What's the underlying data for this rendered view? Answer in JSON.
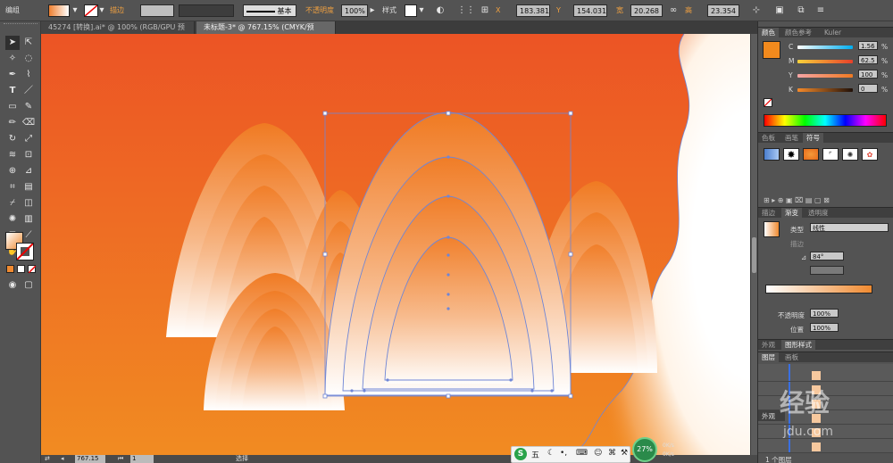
{
  "control_bar": {
    "selection_label": "编组",
    "stroke_label": "描边",
    "stroke_style": "基本",
    "opacity_label": "不透明度",
    "opacity_value": "100%",
    "style_label": "样式",
    "x_label": "X",
    "x_value": "183.381",
    "y_label": "Y",
    "y_value": "154.031",
    "w_label": "宽",
    "w_value": "20.268",
    "h_label": "高",
    "h_value": "23.354"
  },
  "tabs": [
    {
      "label": "45274 [转换].ai* @ 100% (RGB/GPU 预览)",
      "active": false
    },
    {
      "label": "未标题-3* @ 767.15% (CMYK/预览)",
      "active": true
    }
  ],
  "color_panel": {
    "tabs": [
      "颜色",
      "颜色参考",
      "Kuler"
    ],
    "channels": [
      {
        "name": "C",
        "value": "1.56",
        "unit": "%"
      },
      {
        "name": "M",
        "value": "62.5",
        "unit": "%"
      },
      {
        "name": "Y",
        "value": "100",
        "unit": "%"
      },
      {
        "name": "K",
        "value": "0",
        "unit": "%"
      }
    ]
  },
  "symbols_panel": {
    "tabs": [
      "色板",
      "画笔",
      "符号"
    ]
  },
  "gradient_panel": {
    "tabs": [
      "描边",
      "渐变",
      "透明度"
    ],
    "type_label": "类型",
    "type_value": "线性",
    "stroke_label": "描边",
    "angle_value": "84°",
    "opacity_label": "不透明度",
    "opacity_value": "100%",
    "position_label": "位置",
    "position_value": "100%"
  },
  "appearance_tabs": [
    "外观",
    "图形样式"
  ],
  "layers_panel": {
    "tabs": [
      "图层",
      "画板"
    ],
    "side_label": "外观",
    "footer": "1 个图层"
  },
  "status_bar": {
    "zoom": "767.15",
    "page": "1",
    "mode": "选择"
  },
  "ime": {
    "label": "五",
    "percent": "27%",
    "up": "0K/s",
    "down": "0K/s"
  },
  "watermark": {
    "text": "经验",
    "sub": "jdu.com"
  },
  "colors": {
    "bg_orange_top": "#ec5425",
    "bg_orange_bottom": "#f18b22",
    "accent_swatch": "#f28a1d",
    "selection": "#6f86d6"
  }
}
